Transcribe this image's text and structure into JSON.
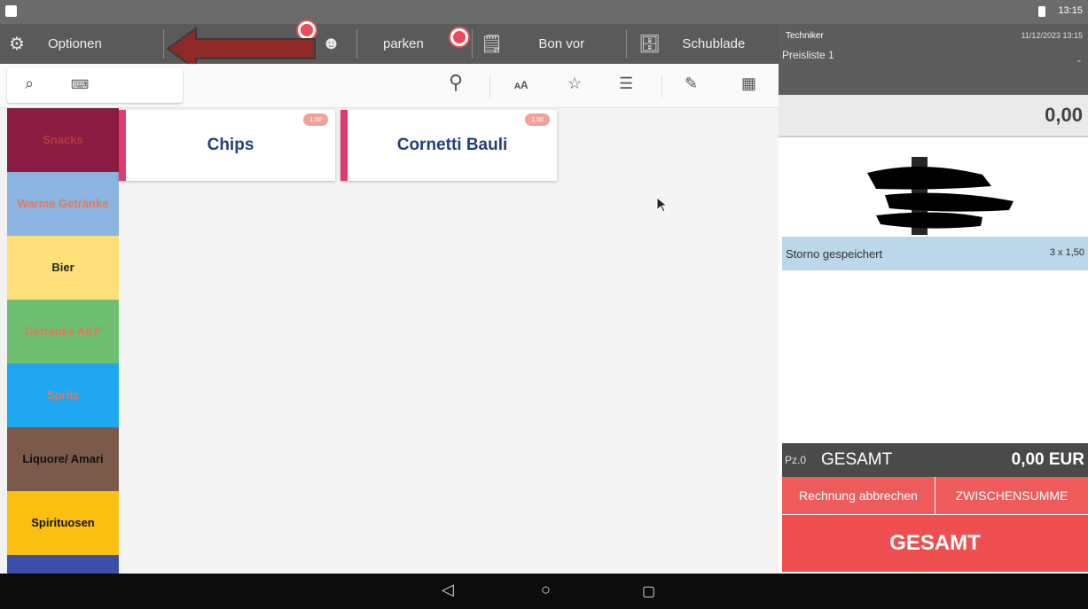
{
  "status": {
    "time": "13:15"
  },
  "toolbar": {
    "options_label": "Optionen",
    "park_label": "parken",
    "bon_label": "Bon vor",
    "drawer_label": "Schublade"
  },
  "categories": [
    {
      "label": "Snacks",
      "bg": "#8b1d43",
      "fg": "#b83a3a"
    },
    {
      "label": "Warme Getränke",
      "bg": "#8cb4e0",
      "fg": "#e07a5a"
    },
    {
      "label": "Bier",
      "bg": "#fde07a",
      "fg": "#222222"
    },
    {
      "label": "Getränke AKF",
      "bg": "#6fbf73",
      "fg": "#e07a5a"
    },
    {
      "label": "Spritz",
      "bg": "#1ea7f0",
      "fg": "#e07a5a"
    },
    {
      "label": "Liquore/ Amari",
      "bg": "#7b5a4c",
      "fg": "#111111"
    },
    {
      "label": "Spirituosen",
      "bg": "#f9c011",
      "fg": "#111111"
    }
  ],
  "products": [
    {
      "name": "Chips",
      "price": "1,50"
    },
    {
      "name": "Cornetti Bauli",
      "price": "1,50"
    }
  ],
  "receipt": {
    "user": "Techniker",
    "datetime": "11/12/2023 13:15",
    "pricelist": "Preisliste 1",
    "dash": "-",
    "amount": "0,00",
    "storno_label": "Storno gespeichert",
    "storno_qty": "3 x 1,50",
    "pz": "Pz.0",
    "total_label": "GESAMT",
    "total_amount": "0,00 EUR",
    "cancel_label": "Rechnung abbrechen",
    "subtotal_label": "ZWISCHENSUMME",
    "pay_label": "GESAMT"
  },
  "colors": {
    "accent_red": "#f04f51",
    "product_stripe": "#e03a6e",
    "storno_bg": "#bcd6ea"
  }
}
